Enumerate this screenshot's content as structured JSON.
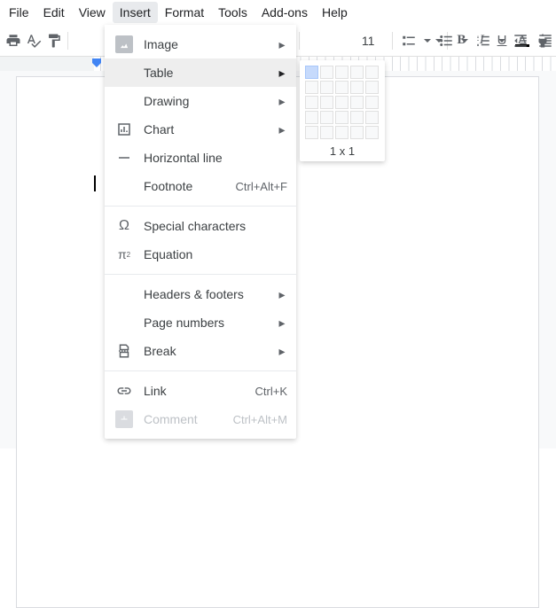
{
  "menubar": {
    "file": "File",
    "edit": "Edit",
    "view": "View",
    "insert": "Insert",
    "format": "Format",
    "tools": "Tools",
    "addons": "Add-ons",
    "help": "Help"
  },
  "toolbar": {
    "font_size": "11"
  },
  "insert_menu": {
    "image": "Image",
    "table": "Table",
    "drawing": "Drawing",
    "chart": "Chart",
    "horizontal_line": "Horizontal line",
    "footnote": "Footnote",
    "footnote_sc": "Ctrl+Alt+F",
    "special_chars": "Special characters",
    "equation": "Equation",
    "headers_footers": "Headers & footers",
    "page_numbers": "Page numbers",
    "break": "Break",
    "link": "Link",
    "link_sc": "Ctrl+K",
    "comment": "Comment",
    "comment_sc": "Ctrl+Alt+M"
  },
  "table_popup": {
    "dimensions": "1 x 1"
  }
}
